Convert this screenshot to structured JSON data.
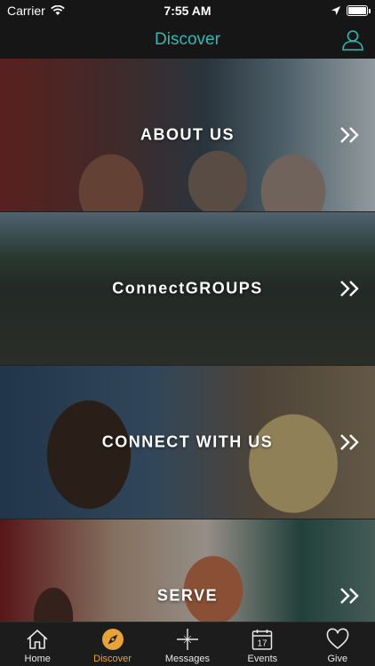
{
  "status": {
    "carrier": "Carrier",
    "time": "7:55 AM"
  },
  "nav": {
    "title": "Discover"
  },
  "cards": [
    {
      "label": "ABOUT US"
    },
    {
      "label": "ConnectGROUPS"
    },
    {
      "label": "CONNECT WITH US"
    },
    {
      "label": "SERVE"
    }
  ],
  "tabs": [
    {
      "label": "Home",
      "icon": "home-icon"
    },
    {
      "label": "Discover",
      "icon": "compass-icon"
    },
    {
      "label": "Messages",
      "icon": "crosshair-icon"
    },
    {
      "label": "Events",
      "icon": "calendar-icon",
      "badge": "17"
    },
    {
      "label": "Give",
      "icon": "heart-icon"
    }
  ],
  "colors": {
    "accent": "#2fb9b3",
    "active_tab": "#e8a23a",
    "bar": "#161616"
  }
}
